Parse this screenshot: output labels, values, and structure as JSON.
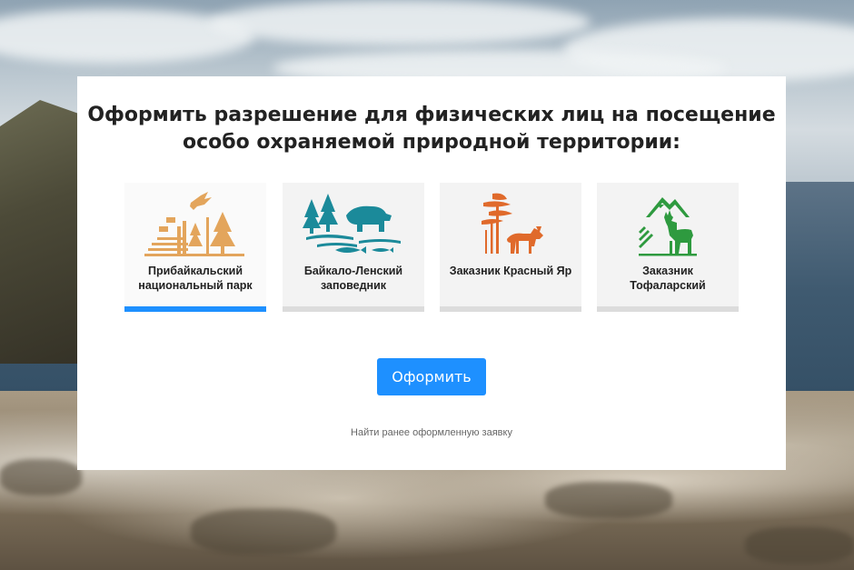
{
  "page": {
    "title_line1": "Оформить разрешение для физических лиц на посещение",
    "title_line2": "особо охраняемой природной территории:"
  },
  "territories": [
    {
      "label_line1": "Прибайкальский",
      "label_line2": "национальный парк",
      "icon": "pribaikalsky-park-logo-icon",
      "selected": true,
      "color": "#e3a55c"
    },
    {
      "label_line1": "Байкало-Ленский",
      "label_line2": "заповедник",
      "icon": "baikalo-lensky-reserve-logo-icon",
      "selected": false,
      "color": "#1b8a9a"
    },
    {
      "label_line1": "Заказник Красный Яр",
      "label_line2": "",
      "icon": "krasny-yar-reserve-logo-icon",
      "selected": false,
      "color": "#e06a2b"
    },
    {
      "label_line1": "Заказник",
      "label_line2": "Тофаларский",
      "icon": "tofalarsky-reserve-logo-icon",
      "selected": false,
      "color": "#2e9a3f"
    }
  ],
  "actions": {
    "submit_label": "Оформить",
    "find_link": "Найти ранее оформленную заявку"
  },
  "colors": {
    "accent": "#1e90ff",
    "tile_bg": "#f3f3f3",
    "tile_bar": "#dcdcdc"
  }
}
